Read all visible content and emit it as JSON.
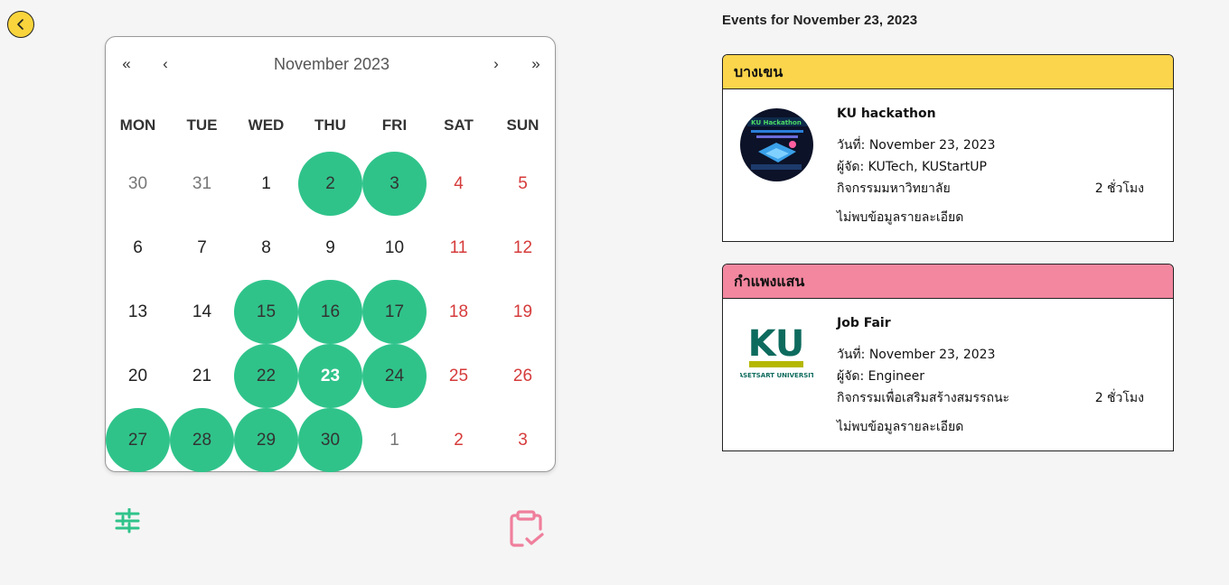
{
  "calendar": {
    "month_label": "November 2023",
    "nav": {
      "prev_year": "«",
      "prev_month": "‹",
      "next_month": "›",
      "next_year": "»"
    },
    "weekdays": [
      "MON",
      "TUE",
      "WED",
      "THU",
      "FRI",
      "SAT",
      "SUN"
    ],
    "days": [
      {
        "label": "30",
        "other_month": true,
        "weekend": false,
        "event": false,
        "selected": false
      },
      {
        "label": "31",
        "other_month": true,
        "weekend": false,
        "event": false,
        "selected": false
      },
      {
        "label": "1",
        "other_month": false,
        "weekend": false,
        "event": false,
        "selected": false
      },
      {
        "label": "2",
        "other_month": false,
        "weekend": false,
        "event": true,
        "selected": false
      },
      {
        "label": "3",
        "other_month": false,
        "weekend": false,
        "event": true,
        "selected": false
      },
      {
        "label": "4",
        "other_month": false,
        "weekend": true,
        "event": false,
        "selected": false
      },
      {
        "label": "5",
        "other_month": false,
        "weekend": true,
        "event": false,
        "selected": false
      },
      {
        "label": "6",
        "other_month": false,
        "weekend": false,
        "event": false,
        "selected": false
      },
      {
        "label": "7",
        "other_month": false,
        "weekend": false,
        "event": false,
        "selected": false
      },
      {
        "label": "8",
        "other_month": false,
        "weekend": false,
        "event": false,
        "selected": false
      },
      {
        "label": "9",
        "other_month": false,
        "weekend": false,
        "event": false,
        "selected": false
      },
      {
        "label": "10",
        "other_month": false,
        "weekend": false,
        "event": false,
        "selected": false
      },
      {
        "label": "11",
        "other_month": false,
        "weekend": true,
        "event": false,
        "selected": false
      },
      {
        "label": "12",
        "other_month": false,
        "weekend": true,
        "event": false,
        "selected": false
      },
      {
        "label": "13",
        "other_month": false,
        "weekend": false,
        "event": false,
        "selected": false
      },
      {
        "label": "14",
        "other_month": false,
        "weekend": false,
        "event": false,
        "selected": false
      },
      {
        "label": "15",
        "other_month": false,
        "weekend": false,
        "event": true,
        "selected": false
      },
      {
        "label": "16",
        "other_month": false,
        "weekend": false,
        "event": true,
        "selected": false
      },
      {
        "label": "17",
        "other_month": false,
        "weekend": false,
        "event": true,
        "selected": false
      },
      {
        "label": "18",
        "other_month": false,
        "weekend": true,
        "event": false,
        "selected": false
      },
      {
        "label": "19",
        "other_month": false,
        "weekend": true,
        "event": false,
        "selected": false
      },
      {
        "label": "20",
        "other_month": false,
        "weekend": false,
        "event": false,
        "selected": false
      },
      {
        "label": "21",
        "other_month": false,
        "weekend": false,
        "event": false,
        "selected": false
      },
      {
        "label": "22",
        "other_month": false,
        "weekend": false,
        "event": true,
        "selected": false
      },
      {
        "label": "23",
        "other_month": false,
        "weekend": false,
        "event": true,
        "selected": true
      },
      {
        "label": "24",
        "other_month": false,
        "weekend": false,
        "event": true,
        "selected": false
      },
      {
        "label": "25",
        "other_month": false,
        "weekend": true,
        "event": false,
        "selected": false
      },
      {
        "label": "26",
        "other_month": false,
        "weekend": true,
        "event": false,
        "selected": false
      },
      {
        "label": "27",
        "other_month": false,
        "weekend": false,
        "event": true,
        "selected": false
      },
      {
        "label": "28",
        "other_month": false,
        "weekend": false,
        "event": true,
        "selected": false
      },
      {
        "label": "29",
        "other_month": false,
        "weekend": false,
        "event": true,
        "selected": false
      },
      {
        "label": "30",
        "other_month": false,
        "weekend": false,
        "event": true,
        "selected": false
      },
      {
        "label": "1",
        "other_month": true,
        "weekend": false,
        "event": false,
        "selected": false
      },
      {
        "label": "2",
        "other_month": true,
        "weekend": true,
        "event": false,
        "selected": false
      },
      {
        "label": "3",
        "other_month": true,
        "weekend": true,
        "event": false,
        "selected": false
      }
    ]
  },
  "events": {
    "title": "Events for November 23, 2023",
    "cards": [
      {
        "campus": "บางเขน",
        "header_color": "#fbd54b",
        "name": "KU hackathon",
        "date": "วันที่: November 23, 2023",
        "organizer": "ผู้จัด: KUTech, KUStartUP",
        "category": "กิจกรรมมหาวิทยาลัย",
        "duration": "2 ชั่วโมง",
        "detail": "ไม่พบข้อมูลรายละเอียด",
        "thumb_text": "KU Hackathon"
      },
      {
        "campus": "กำแพงแสน",
        "header_color": "#f2879f",
        "name": "Job Fair",
        "date": "วันที่: November 23, 2023",
        "organizer": "ผู้จัด: Engineer",
        "category": "กิจกรรมเพื่อเสริมสร้างสมรรถนะ",
        "duration": "2 ชั่วโมง",
        "detail": "ไม่พบข้อมูลรายละเอียด",
        "logo_text": "KU",
        "logo_sub": "KASETSART UNIVERSITY"
      }
    ]
  },
  "colors": {
    "event_day": "#2fc38a",
    "weekend": "#d63b3b",
    "back_button": "#f9d43c",
    "filter_icon": "#2fc38a",
    "clipboard_icon": "#ef7f9c"
  },
  "icons": {
    "back": "chevron-left-icon",
    "filter": "sliders-icon",
    "clipboard": "clipboard-check-icon"
  }
}
